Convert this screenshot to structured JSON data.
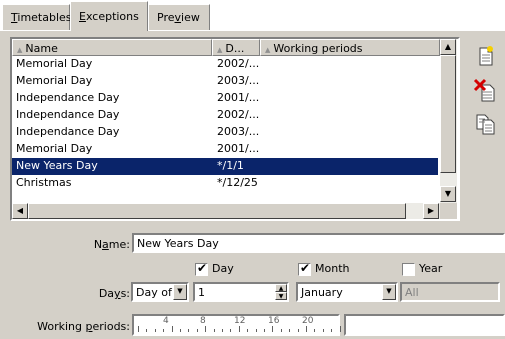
{
  "tabs": [
    {
      "label": "Timetables",
      "underline": "T",
      "rest": "imetables",
      "active": false
    },
    {
      "label": "Exceptions",
      "underline": "E",
      "rest": "xceptions",
      "active": true
    },
    {
      "label": "Preview",
      "pre": "Pre",
      "underline": "v",
      "rest": "iew",
      "active": false
    }
  ],
  "list": {
    "columns": [
      "Name",
      "D...",
      "Working periods"
    ],
    "rows": [
      {
        "name": "Memorial Day",
        "date": "2002/..."
      },
      {
        "name": "Memorial Day",
        "date": "2003/..."
      },
      {
        "name": "Independance Day",
        "date": "2001/..."
      },
      {
        "name": "Independance Day",
        "date": "2002/..."
      },
      {
        "name": "Independance Day",
        "date": "2003/..."
      },
      {
        "name": "Memorial Day",
        "date": "2001/..."
      },
      {
        "name": "New Years Day",
        "date": "*/1/1",
        "selected": true
      },
      {
        "name": "Christmas",
        "date": "*/12/25"
      }
    ]
  },
  "toolbar": {
    "new_icon": "new-document-icon",
    "delete_icon": "delete-document-icon",
    "copy_icon": "copy-document-icon"
  },
  "form": {
    "name_label": {
      "pre": "N",
      "u": "a",
      "post": "me:"
    },
    "name_value": "New Years Day",
    "day_check": {
      "label": "Day",
      "checked": true
    },
    "month_check": {
      "label": "Month",
      "checked": true
    },
    "year_check": {
      "label": "Year",
      "checked": false
    },
    "days_label": {
      "pre": "Da",
      "u": "y",
      "post": "s:"
    },
    "days_type": "Day of",
    "day_value": "1",
    "month_value": "January",
    "year_value": "All",
    "periods_label": {
      "pre": "Working ",
      "u": "p",
      "post": "eriods:"
    },
    "ruler_ticks": [
      "4",
      "8",
      "12",
      "16",
      "20"
    ]
  },
  "colors": {
    "selection": "#0a246a",
    "face": "#d4d0c8"
  }
}
